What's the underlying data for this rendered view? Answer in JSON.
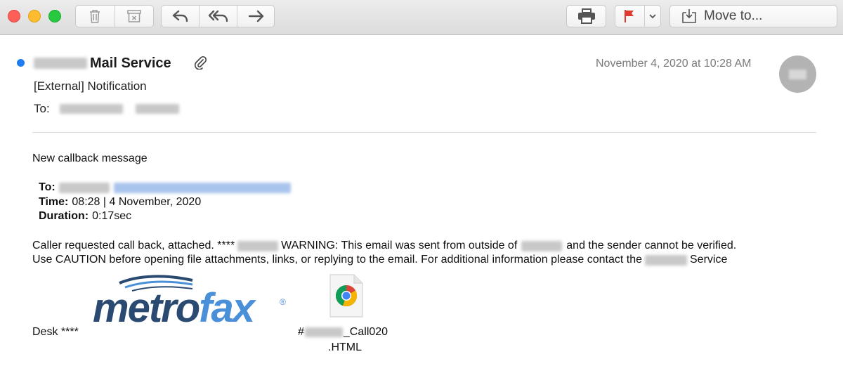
{
  "toolbar": {
    "move_label": "Move to...",
    "icons": [
      "trash-icon",
      "archive-icon",
      "reply-icon",
      "reply-all-icon",
      "forward-icon",
      "print-icon",
      "flag-icon",
      "chevron-down-icon",
      "move-to-icon"
    ]
  },
  "header": {
    "sender": "Mail Service",
    "subject": "[External] Notification",
    "to_label": "To:",
    "date": "November 4, 2020 at 10:28 AM",
    "unread_color": "#1d7cf2"
  },
  "body": {
    "intro": "New callback message",
    "to_label": "To:",
    "time_label": "Time:",
    "time_value": "08:28 | 4 November, 2020",
    "duration_label": "Duration:",
    "duration_value": "0:17sec",
    "line1_a": "Caller requested call back, attached. ****",
    "line1_b": "WARNING: This email was sent from outside of",
    "line1_c": "and the sender cannot be verified.",
    "line2_a": "Use CAUTION before opening file attachments, links, or replying to the email. For additional information please contact the",
    "line2_b": "Service",
    "desk": "Desk ****"
  },
  "logo": {
    "part1": "metro",
    "part2": "fax",
    "reg": "®"
  },
  "attachment": {
    "prefix": "#",
    "suffix": "_Call020",
    "extension": ".HTML"
  }
}
